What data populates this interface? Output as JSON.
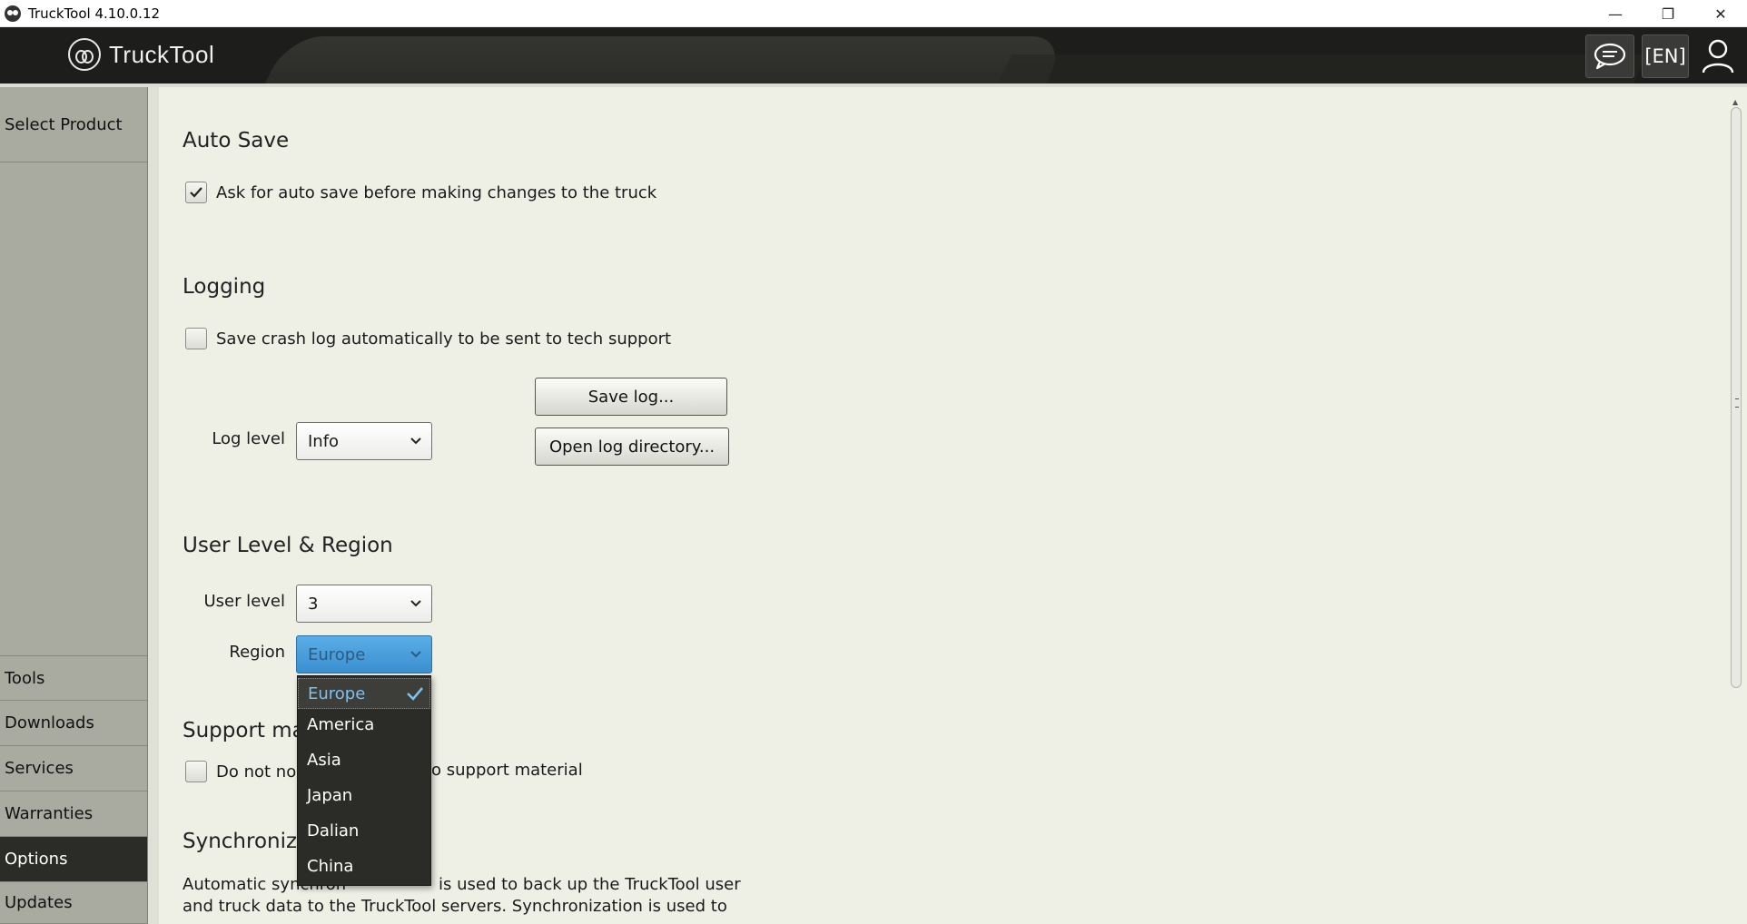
{
  "window": {
    "title": "TruckTool 4.10.0.12",
    "minimize": "—",
    "restore": "❐",
    "close": "✕"
  },
  "header": {
    "logo_text": "TruckTool",
    "language": "[EN]"
  },
  "sidebar": {
    "items": [
      {
        "label": "Select Product",
        "active": false
      },
      {
        "label": "Tools",
        "active": false
      },
      {
        "label": "Downloads",
        "active": false
      },
      {
        "label": "Services",
        "active": false
      },
      {
        "label": "Warranties",
        "active": false
      },
      {
        "label": "Options",
        "active": true
      },
      {
        "label": "Updates",
        "active": false
      }
    ]
  },
  "auto_save": {
    "title": "Auto Save",
    "ask_label": "Ask for auto save before making changes to the truck",
    "ask_checked": true
  },
  "logging": {
    "title": "Logging",
    "crash_label": "Save crash log automatically to be sent to tech support",
    "crash_checked": false,
    "log_level_label": "Log level",
    "log_level_value": "Info",
    "save_log": "Save log...",
    "open_dir": "Open log directory..."
  },
  "user_region": {
    "title": "User Level & Region",
    "user_level_label": "User level",
    "user_level_value": "3",
    "region_label": "Region",
    "region_value": "Europe",
    "region_options": [
      "Europe",
      "America",
      "Asia",
      "Japan",
      "Dalian",
      "China"
    ],
    "region_selected": "Europe"
  },
  "support": {
    "title_visible": "Support ma",
    "notify_label_left": "Do not no",
    "notify_label_right": "o support material",
    "notify_checked": false
  },
  "sync": {
    "title_visible": "Synchroniz",
    "text_line1_left": "Automatic synchron",
    "text_line1_right": "is used to back up the TruckTool user",
    "text_line2": "and truck data to the TruckTool servers. Synchronization is used to"
  },
  "colors": {
    "sidebar_active": "#2b2c28",
    "region_open": "#3a8fd0",
    "dropdown_bg": "#2b2c28"
  }
}
